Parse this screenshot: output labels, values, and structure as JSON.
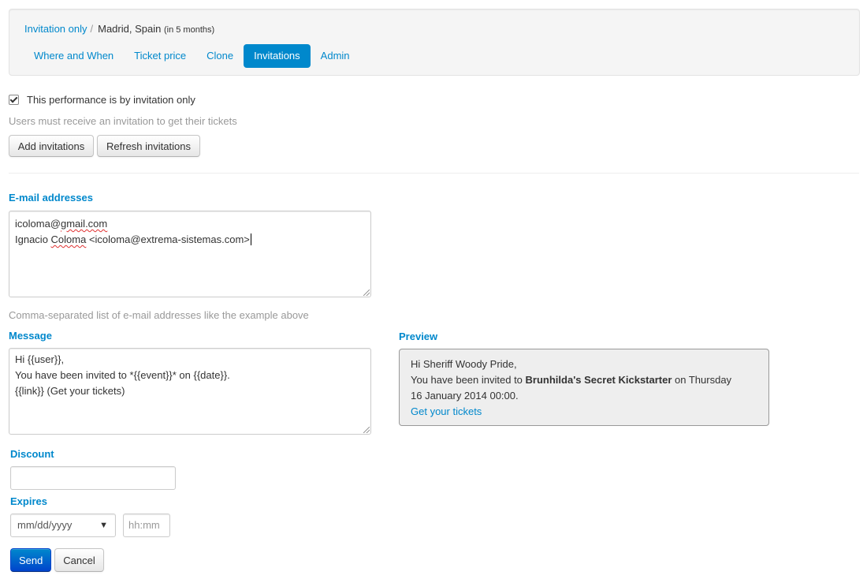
{
  "breadcrumb": {
    "link": "Invitation only",
    "separator": "/",
    "current": "Madrid, Spain",
    "when": "(in 5 months)"
  },
  "tabs": [
    {
      "label": "Where and When",
      "active": false
    },
    {
      "label": "Ticket price",
      "active": false
    },
    {
      "label": "Clone",
      "active": false
    },
    {
      "label": "Invitations",
      "active": true
    },
    {
      "label": "Admin",
      "active": false
    }
  ],
  "invitation_only": {
    "checked": true,
    "label": "This performance is by invitation only",
    "help": "Users must receive an invitation to get their tickets"
  },
  "actions": {
    "add_label": "Add invitations",
    "refresh_label": "Refresh invitations"
  },
  "emails": {
    "label": "E-mail addresses",
    "line1_pre": "icoloma@",
    "line1_err": "gmail.com",
    "line2_pre": "Ignacio ",
    "line2_err": "Coloma",
    "line2_post": " <icoloma@extrema-sistemas.com>",
    "help": "Comma-separated list of e-mail addresses like the example above"
  },
  "message": {
    "label": "Message",
    "lines": [
      "Hi {{user}},",
      "You have been invited to *{{event}}* on {{date}}.",
      "{{link}} (Get your tickets)"
    ]
  },
  "preview": {
    "label": "Preview",
    "greeting": "Hi Sheriff Woody Pride,",
    "invited_pre": "You have been invited to ",
    "event": "Brunhilda's Secret Kickstarter",
    "invited_post": " on Thursday",
    "date": "16 January 2014 00:00.",
    "link": "Get your tickets"
  },
  "discount": {
    "label": "Discount",
    "value": ""
  },
  "expires": {
    "label": "Expires",
    "date_placeholder": "mm/dd/yyyy",
    "time_placeholder": "hh:mm"
  },
  "form_buttons": {
    "send_label": "Send",
    "cancel_label": "Cancel"
  },
  "colors": {
    "accent": "#0088cc",
    "preview_bg": "#eeeeee"
  }
}
